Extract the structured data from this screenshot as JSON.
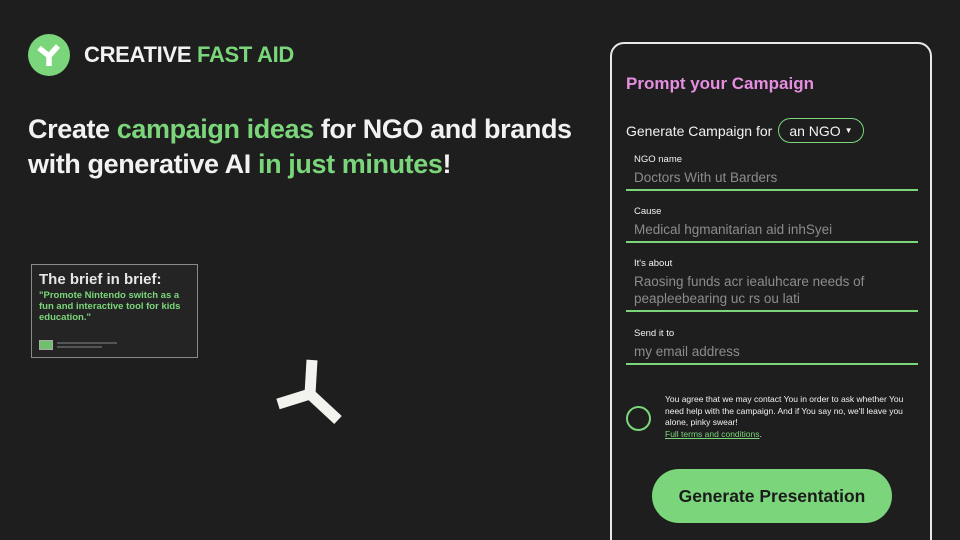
{
  "brand": {
    "logo_icon": "y-shape-icon",
    "name_part1": "CREATIVE ",
    "name_part2": "FAST AID",
    "accent_color": "#7bd67b"
  },
  "hero": {
    "line1_a": "Create ",
    "line1_b": "campaign ideas",
    "line1_c": " for NGO and brands",
    "line2_a": "with generative AI ",
    "line2_b": "in just minutes",
    "line2_c": "!"
  },
  "brief": {
    "title": "The brief in brief:",
    "quote": "\"Promote Nintendo switch as a fun and interactive tool for kids education.\""
  },
  "form": {
    "title": "Prompt your Campaign",
    "title_color": "#e68ee0",
    "generate_for_label": "Generate Campaign for",
    "target_select": "an NGO",
    "fields": [
      {
        "label": "NGO name",
        "placeholder": "Doctors With ut Barders"
      },
      {
        "label": "Cause",
        "placeholder": "Medical hgmanitarian aid inhSyei"
      },
      {
        "label": "It's about",
        "placeholder": "Raosing funds acr iealuhcare needs of peapleebearing uc rs ou lati"
      },
      {
        "label": "Send it to",
        "placeholder": "my email address"
      }
    ],
    "consent_text": "You agree that we may contact You in order to ask whether You need help with the campaign. And if You say no, we'll leave you alone, pinky swear!",
    "terms_link": "Full terms and conditions",
    "terms_period": ".",
    "submit_label": "Generate Presentation"
  }
}
